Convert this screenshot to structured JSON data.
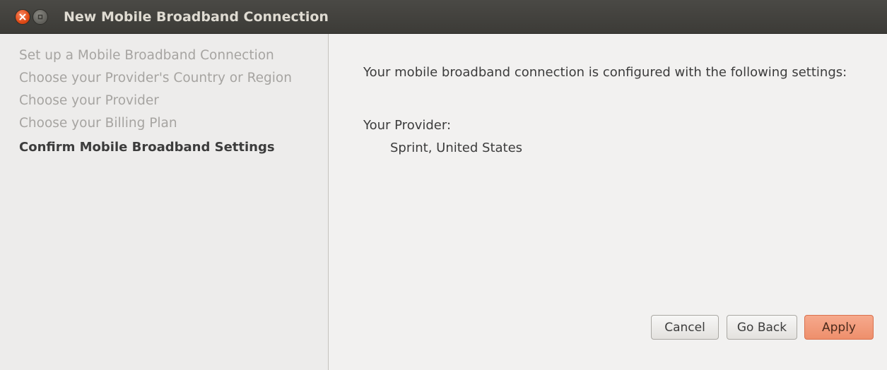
{
  "window": {
    "title": "New Mobile Broadband Connection",
    "close_icon": "close-icon",
    "minimize_icon": "minimize-icon"
  },
  "sidebar": {
    "steps": [
      {
        "label": "Set up a Mobile Broadband Connection",
        "current": false
      },
      {
        "label": "Choose your Provider's Country or Region",
        "current": false
      },
      {
        "label": "Choose your Provider",
        "current": false
      },
      {
        "label": "Choose your Billing Plan",
        "current": false
      },
      {
        "label": "Confirm Mobile Broadband Settings",
        "current": true
      }
    ]
  },
  "main": {
    "intro": "Your mobile broadband connection is configured with the following settings:",
    "provider_label": "Your Provider:",
    "provider_value": "Sprint, United States"
  },
  "buttons": {
    "cancel": "Cancel",
    "go_back": "Go Back",
    "apply": "Apply"
  },
  "colors": {
    "titlebar": "#3c3b37",
    "accent": "#ef9571",
    "sidebar_bg": "#edeceb",
    "content_bg": "#f2f1f0"
  }
}
